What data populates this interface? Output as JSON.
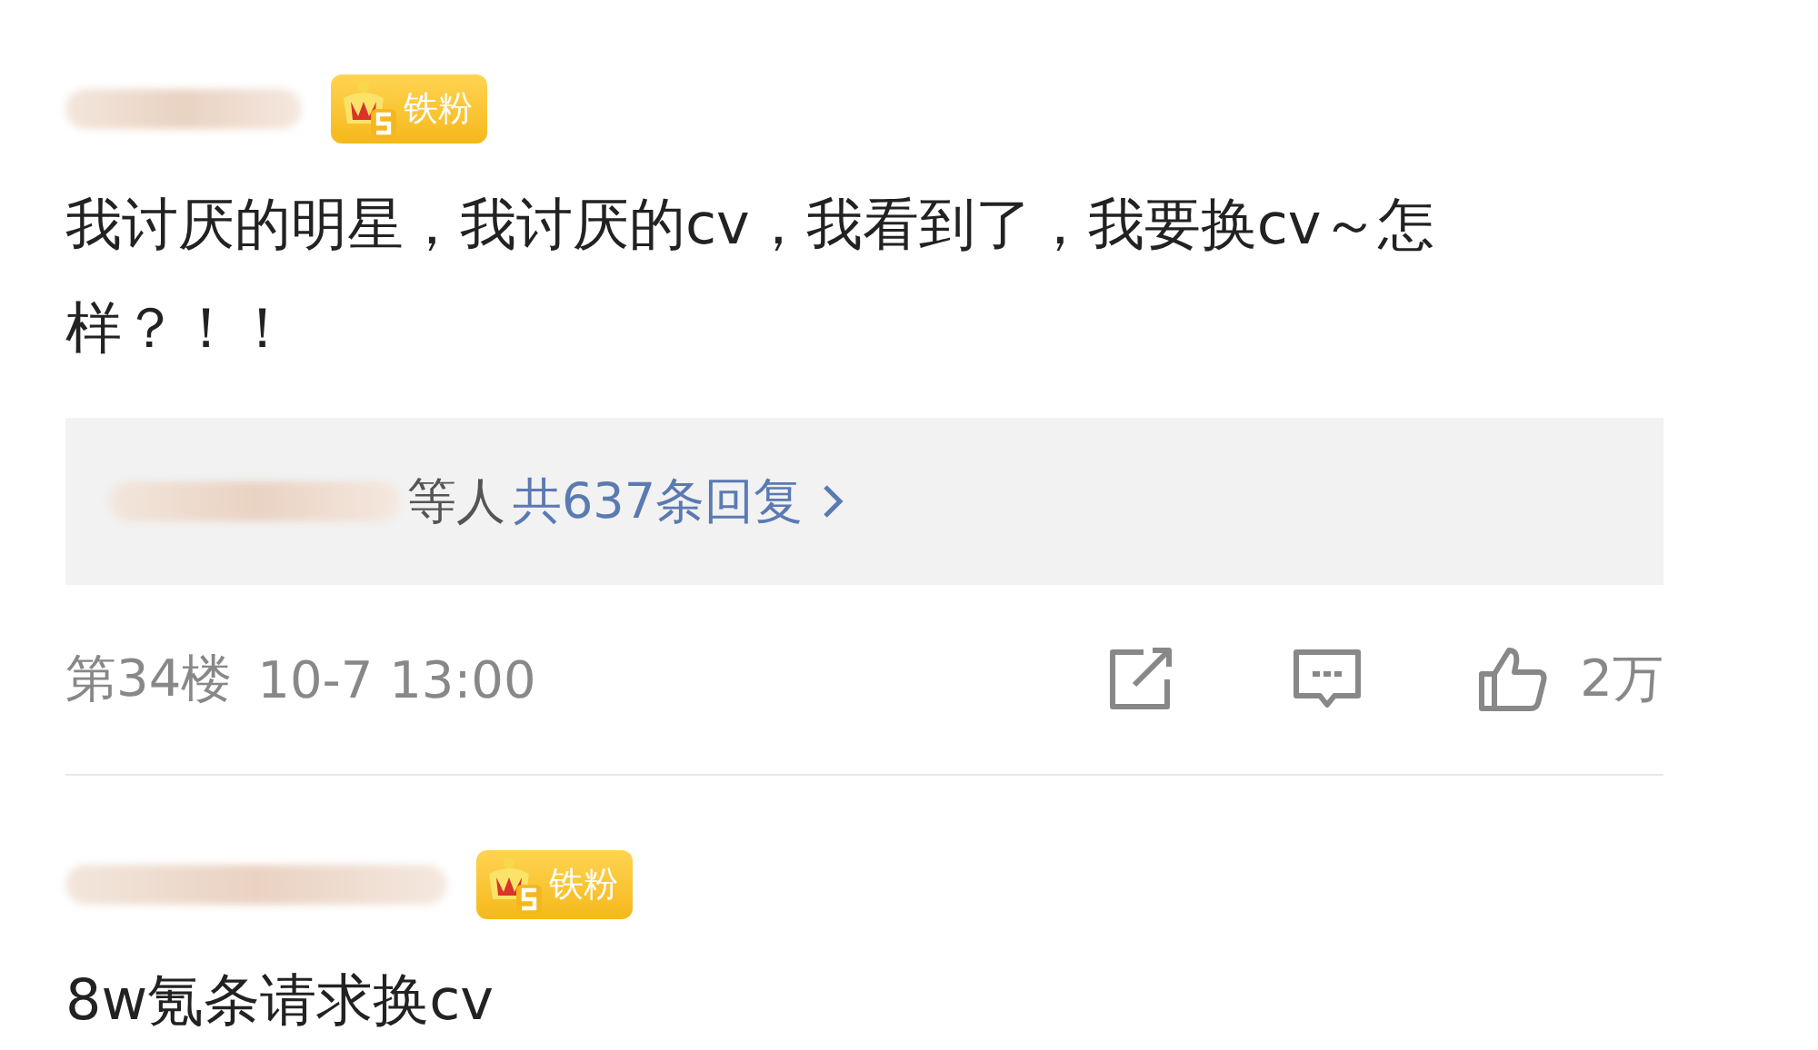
{
  "comments": [
    {
      "badge": "铁粉",
      "content": "我讨厌的明星，我讨厌的cv，我看到了，我要换cv～怎样？！！",
      "replies": {
        "suffix": "等人",
        "link": "共637条回复"
      },
      "footer": {
        "floor": "第34楼",
        "time": "10-7 13:00",
        "likes": "2万"
      }
    },
    {
      "badge": "铁粉",
      "content": "8w氪条请求换cv"
    }
  ]
}
